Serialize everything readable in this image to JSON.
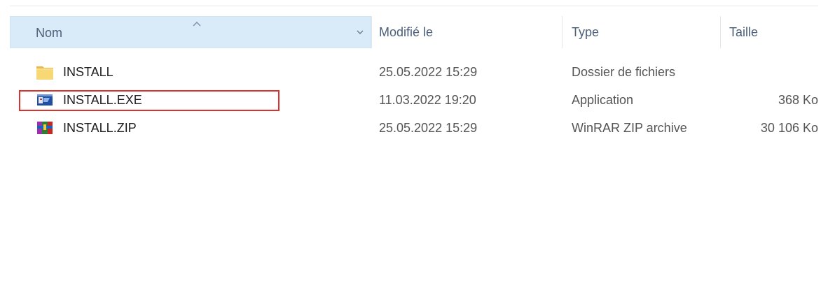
{
  "columns": {
    "name": "Nom",
    "modified": "Modifié le",
    "type": "Type",
    "size": "Taille"
  },
  "files": [
    {
      "name": "INSTALL",
      "modified": "25.05.2022 15:29",
      "type": "Dossier de fichiers",
      "size": "",
      "icon": "folder-icon"
    },
    {
      "name": "INSTALL.EXE",
      "modified": "11.03.2022 19:20",
      "type": "Application",
      "size": "368 Ko",
      "icon": "application-icon"
    },
    {
      "name": "INSTALL.ZIP",
      "modified": "25.05.2022 15:29",
      "type": "WinRAR ZIP archive",
      "size": "30 106 Ko",
      "icon": "winrar-archive-icon"
    }
  ],
  "colors": {
    "header_text": "#4c607a",
    "header_selected_bg": "#d9ebf9",
    "highlight_border": "#d9342b",
    "folder_yellow": "#f8d775"
  }
}
